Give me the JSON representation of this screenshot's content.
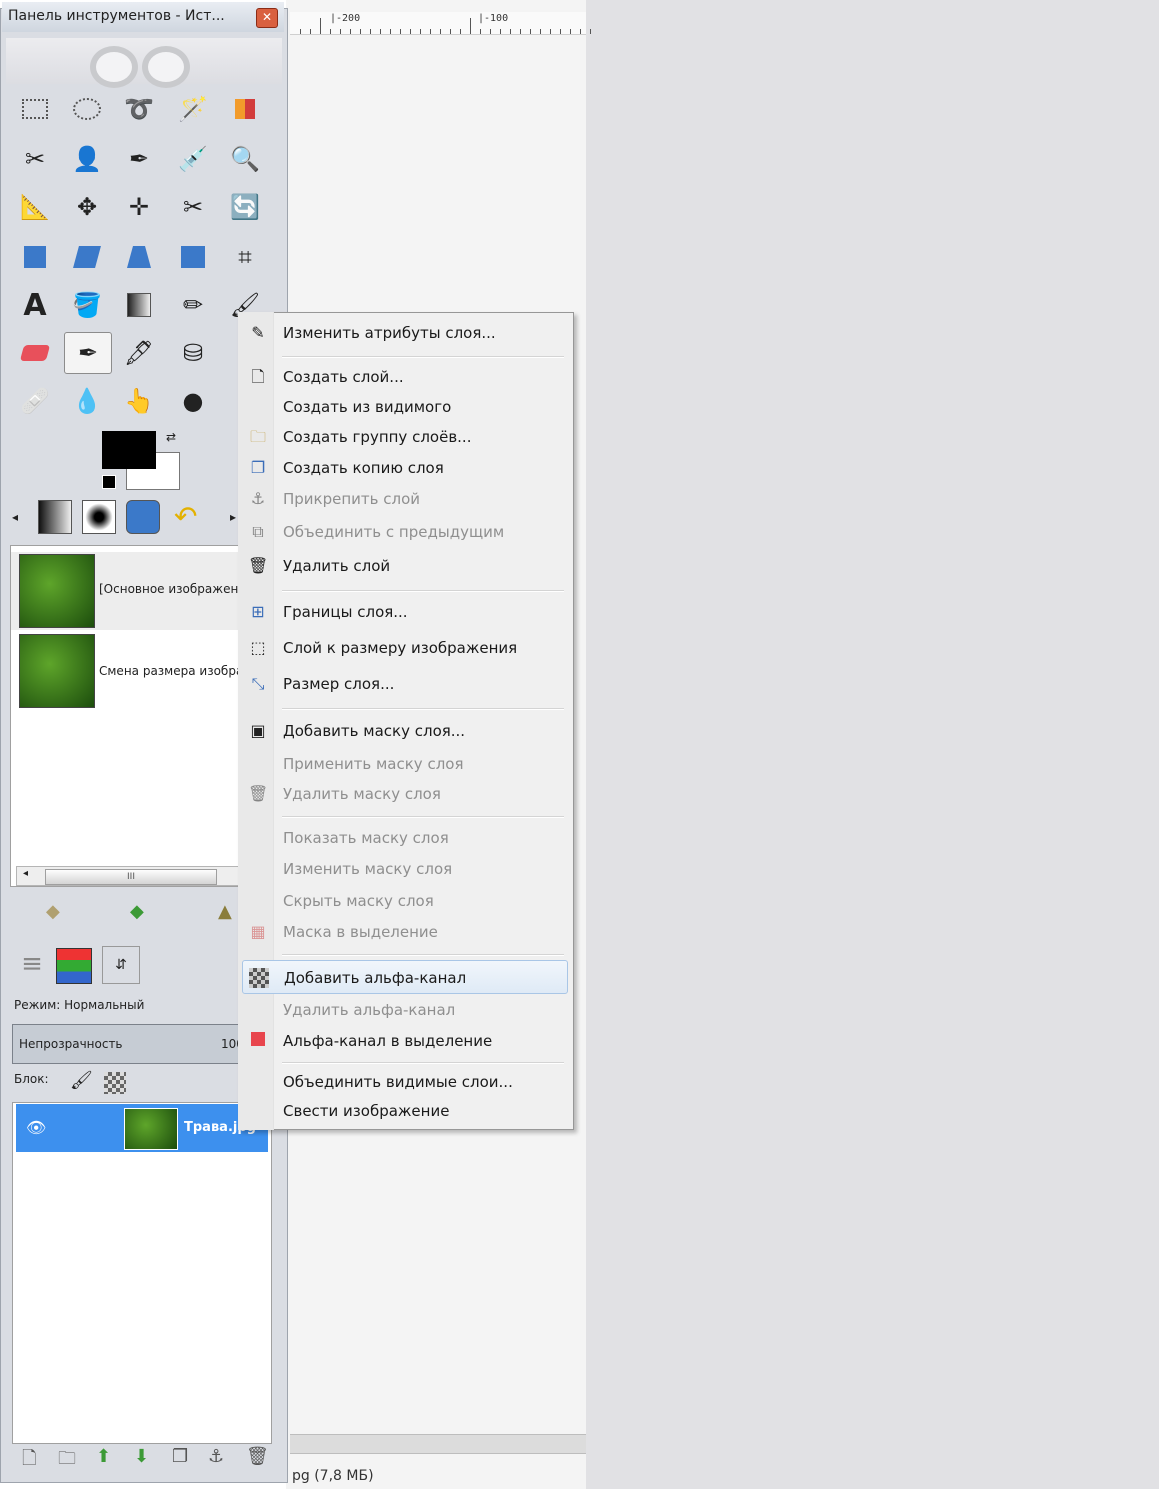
{
  "toolbox": {
    "title": "Панель инструментов - Ист...",
    "close_label": "✕"
  },
  "ruler": {
    "label_a": "|-200",
    "label_b": "|-100"
  },
  "status": {
    "text": "pg (7,8 МБ)"
  },
  "images": {
    "items": [
      {
        "label": "[Основное изображение]"
      },
      {
        "label": "Смена размера изображения"
      }
    ],
    "scroll_grip": "III"
  },
  "layers": {
    "mode_label": "Режим:",
    "mode_value": "Нормальный",
    "opacity_label": "Непрозрачность",
    "opacity_value": "100",
    "lock_label": "Блок:",
    "layer_name": "Трава.jpg"
  },
  "context_menu": {
    "items": [
      {
        "label": "Изменить атрибуты слоя...",
        "icon": "edit-icon"
      },
      {
        "label": "Создать слой...",
        "icon": "new-layer-icon"
      },
      {
        "label": "Создать из видимого",
        "icon": ""
      },
      {
        "label": "Создать группу слоёв...",
        "icon": "folder-icon"
      },
      {
        "label": "Создать копию слоя",
        "icon": "duplicate-icon"
      },
      {
        "label": "Прикрепить слой",
        "icon": "anchor-icon"
      },
      {
        "label": "Объединить с предыдущим",
        "icon": "merge-icon"
      },
      {
        "label": "Удалить слой",
        "icon": "trash-icon"
      },
      {
        "label": "Границы слоя...",
        "icon": "layer-boundary-icon"
      },
      {
        "label": "Слой к размеру изображения",
        "icon": "layer-to-image-size-icon"
      },
      {
        "label": "Размер слоя...",
        "icon": "scale-layer-icon"
      },
      {
        "label": "Добавить маску слоя...",
        "icon": "add-mask-icon"
      },
      {
        "label": "Применить маску слоя",
        "icon": ""
      },
      {
        "label": "Удалить маску слоя",
        "icon": "delete-mask-icon"
      },
      {
        "label": "Показать маску слоя",
        "icon": ""
      },
      {
        "label": "Изменить маску слоя",
        "icon": ""
      },
      {
        "label": "Скрыть маску слоя",
        "icon": ""
      },
      {
        "label": "Маска в выделение",
        "icon": "mask-to-selection-icon"
      },
      {
        "label": "Добавить альфа-канал",
        "icon": "checkerboard-icon"
      },
      {
        "label": "Удалить альфа-канал",
        "icon": ""
      },
      {
        "label": "Альфа-канал в выделение",
        "icon": "alpha-to-selection-icon"
      },
      {
        "label": "Объединить видимые слои...",
        "icon": ""
      },
      {
        "label": "Свести изображение",
        "icon": ""
      }
    ]
  },
  "colors": {
    "selection_blue": "#3d90ee",
    "menu_bg": "#f0f0f0",
    "disabled_text": "#8f8f8f",
    "right_gray": "#e1e1e4"
  }
}
